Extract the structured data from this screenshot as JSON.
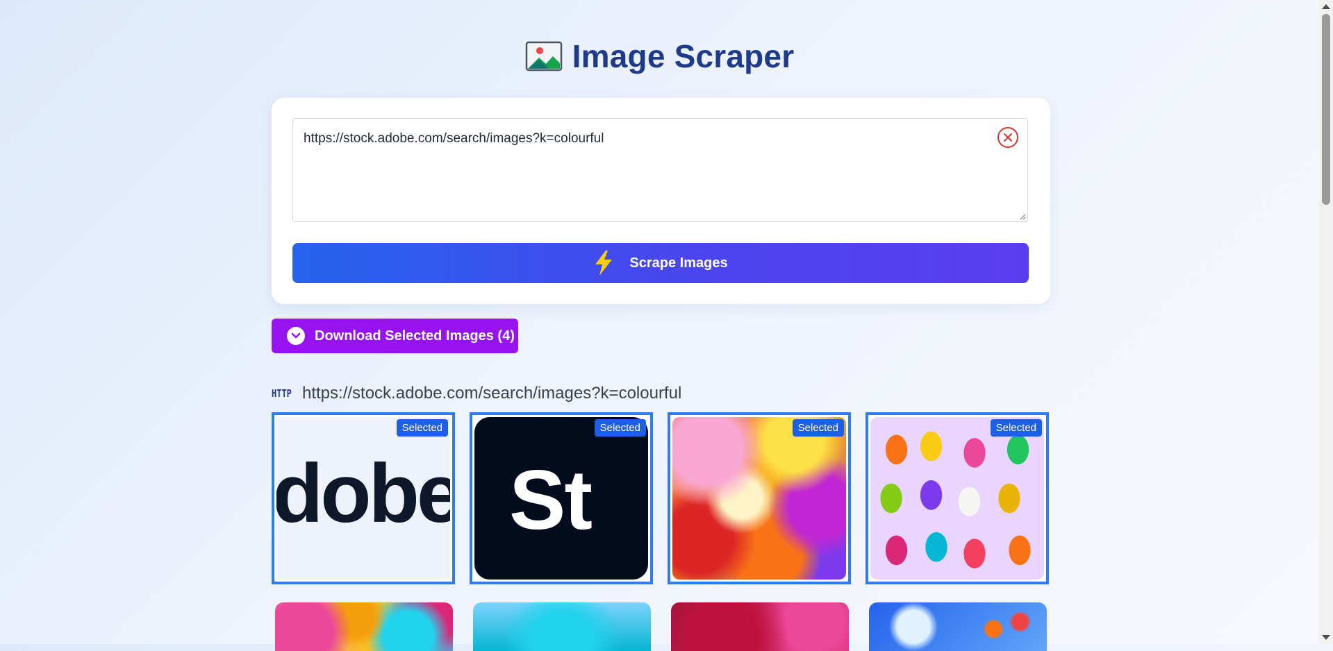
{
  "app": {
    "title": "Image Scraper",
    "title_icon": "picture-icon"
  },
  "input": {
    "url": "https://stock.adobe.com/search/images?k=colourful",
    "clear_icon": "close-circle-icon"
  },
  "scrape_button": {
    "label": "Scrape Images",
    "icon": "lightning-icon"
  },
  "download_button": {
    "label": "Download Selected Images (4)",
    "icon": "chevron-down-circle-icon"
  },
  "results": {
    "source_tag": "HTTP",
    "source_url": "https://stock.adobe.com/search/images?k=colourful",
    "selected_badge": "Selected",
    "images": [
      {
        "description": "adobe-wordmark",
        "selected": true,
        "wordmark_text": "dobe"
      },
      {
        "description": "adobe-stock-logo",
        "selected": true,
        "logo_text": "St"
      },
      {
        "description": "colourful-petals",
        "selected": true
      },
      {
        "description": "macarons",
        "selected": true
      },
      {
        "description": "umbrellas",
        "selected": false
      },
      {
        "description": "blue-watercolour",
        "selected": false
      },
      {
        "description": "red-pink-smoke",
        "selected": false
      },
      {
        "description": "blue-wall-flowerpots",
        "selected": false
      }
    ]
  },
  "colors": {
    "title": "#1e3a8a",
    "scrape_gradient_start": "#2563eb",
    "scrape_gradient_end": "#5b3df0",
    "download": "#9813f2",
    "selected_border": "#2f7bf0",
    "badge": "#1d5fe6",
    "clear": "#e03131"
  }
}
